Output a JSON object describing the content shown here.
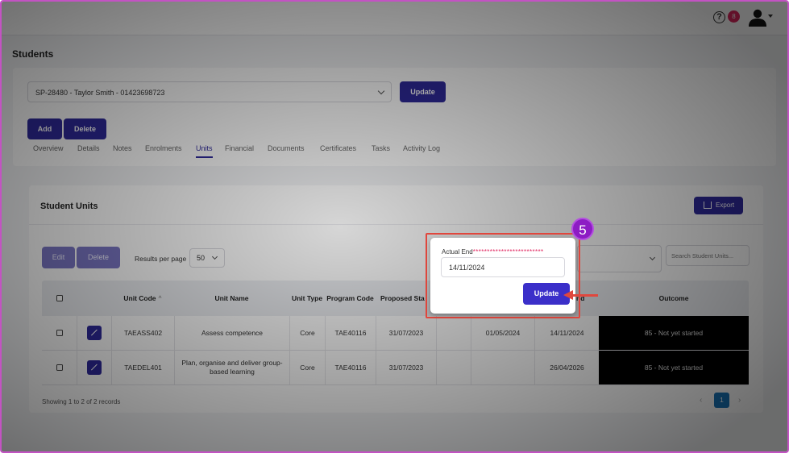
{
  "header": {
    "help_icon": "question-circle-icon",
    "notification_count": "8",
    "user_icon": "user-silhouette-icon"
  },
  "page": {
    "title": "Students"
  },
  "student_selector": {
    "value": "SP-28480 - Taylor Smith - 01423698723",
    "update_label": "Update"
  },
  "actions": {
    "add_label": "Add",
    "delete_label": "Delete"
  },
  "tabs": [
    "Overview",
    "Details",
    "Notes",
    "Enrolments",
    "Units",
    "Financial",
    "Documents",
    "Certificates",
    "Tasks",
    "Activity Log"
  ],
  "active_tab": "Units",
  "student_units": {
    "title": "Student Units",
    "export_label": "Export",
    "edit_label": "Edit",
    "delete_label": "Delete",
    "results_per_page_label": "Results per page",
    "results_per_page_value": "50",
    "search_placeholder": "Search Student Units...",
    "columns": [
      "Unit Code",
      "Unit Name",
      "Unit Type",
      "Program Code",
      "Proposed Sta",
      "Actual End",
      "Outcome"
    ],
    "column_partial_end": "nd",
    "rows": [
      {
        "unit_code": "TAEASS402",
        "unit_name": "Assess competence",
        "unit_type": "Core",
        "program_code": "TAE40116",
        "proposed_start": "31/07/2023",
        "col6": "",
        "col7": "01/05/2024",
        "actual_end": "14/11/2024",
        "outcome": "85 - Not yet started"
      },
      {
        "unit_code": "TAEDEL401",
        "unit_name": "Plan, organise and deliver group-based learning",
        "unit_type": "Core",
        "program_code": "TAE40116",
        "proposed_start": "31/07/2023",
        "col6": "",
        "col7": "",
        "actual_end": "26/04/2026",
        "outcome": "85 - Not yet started"
      }
    ],
    "records_info": "Showing 1 to 2 of 2 records",
    "pager": {
      "prev": "‹",
      "current": "1",
      "next": "›"
    }
  },
  "modal": {
    "label": "Actual End",
    "required_dots": "*************************",
    "date_value": "14/11/2024",
    "update_label": "Update"
  },
  "annotation": {
    "step": "5",
    "highlight_color": "#e0473d",
    "step_color": "#8d1cc4"
  },
  "colors": {
    "primary": "#2f2a9c",
    "badge": "#e0245e",
    "pager_active": "#1874b8"
  }
}
